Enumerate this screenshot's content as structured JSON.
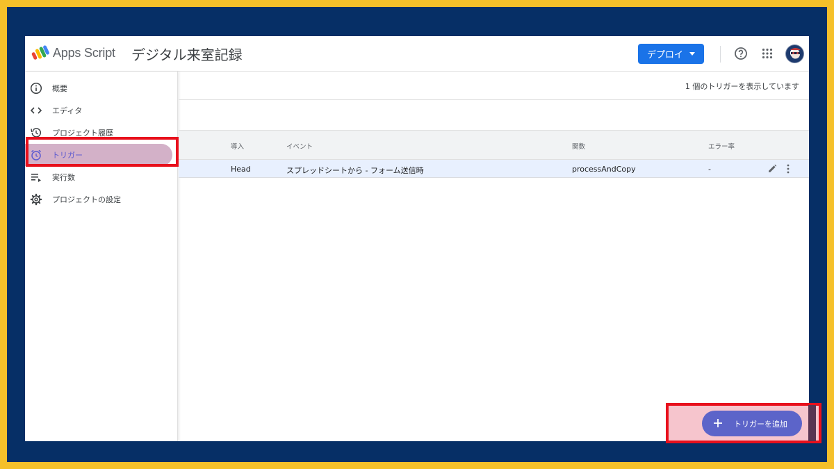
{
  "header": {
    "brand": "Apps Script",
    "project_title": "デジタル来室記録",
    "deploy_label": "デプロイ",
    "icons": [
      "apps-script-logo-icon",
      "help-icon",
      "apps-grid-icon",
      "avatar"
    ]
  },
  "sidebar": {
    "items": [
      {
        "label": "概要",
        "icon": "info-icon"
      },
      {
        "label": "エディタ",
        "icon": "code-icon"
      },
      {
        "label": "プロジェクト履歴",
        "icon": "history-icon"
      },
      {
        "label": "トリガー",
        "icon": "alarm-clock-icon",
        "active": true
      },
      {
        "label": "実行数",
        "icon": "executions-list-icon"
      },
      {
        "label": "プロジェクトの設定",
        "icon": "gear-icon"
      }
    ]
  },
  "main": {
    "info_text": "1 個のトリガーを表示しています",
    "table": {
      "columns": [
        "導入",
        "イベント",
        "関数",
        "エラー率"
      ],
      "rows": [
        {
          "deployment": "Head",
          "event": "スプレッドシートから - フォーム送信時",
          "function": "processAndCopy",
          "error_rate": "-"
        }
      ]
    },
    "add_trigger_label": "トリガーを追加"
  },
  "colors": {
    "frame_border": "#f5c02a",
    "frame_bg": "#062f66",
    "accent_blue": "#1a73e8",
    "highlight_red": "#e8101c",
    "fab": "#5c64c9",
    "active_nav": "#d3b1c8"
  }
}
